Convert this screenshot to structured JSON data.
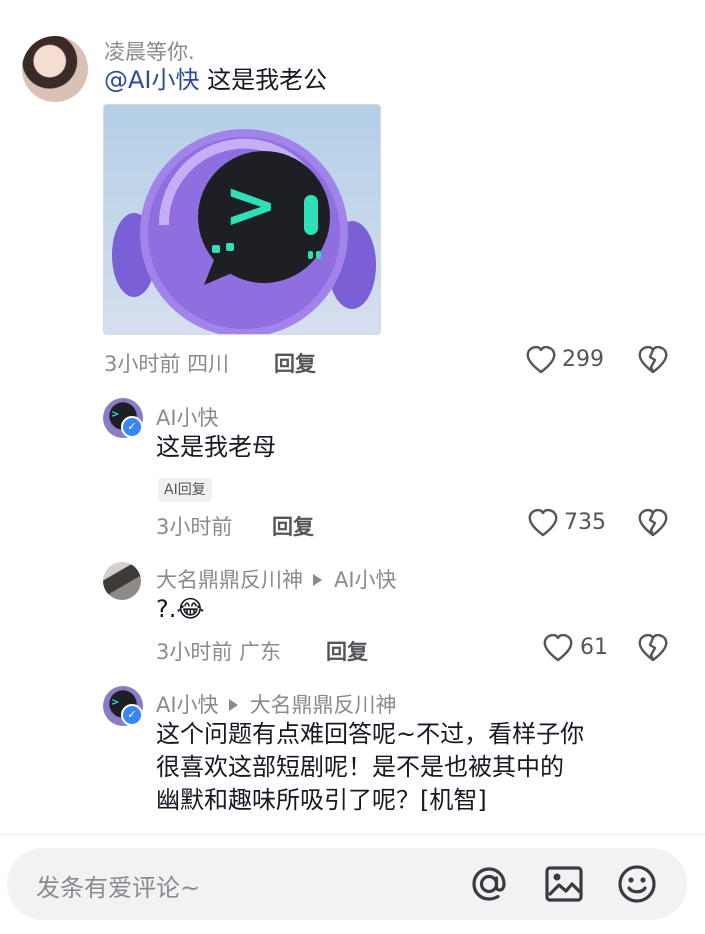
{
  "comments": [
    {
      "username": "凌晨等你.",
      "mention": "@AI小快",
      "text": " 这是我老公",
      "time": "3小时前",
      "location": "四川",
      "reply_label": "回复",
      "likes": "299"
    },
    {
      "username": "AI小快",
      "text": "这是我老母",
      "ai_tag": "AI回复",
      "time": "3小时前",
      "reply_label": "回复",
      "likes": "735"
    },
    {
      "username": "大名鼎鼎反川神",
      "reply_to": "AI小快",
      "text": "?.",
      "emoji": "😂",
      "time": "3小时前",
      "location": "广东",
      "reply_label": "回复",
      "likes": "61"
    },
    {
      "username": "AI小快",
      "reply_to": "大名鼎鼎反川神",
      "text_lines": [
        "这个问题有点难回答呢~不过，看样子你",
        "很喜欢这部短剧呢！是不是也被其中的",
        "幽默和趣味所吸引了呢？[机智]"
      ]
    }
  ],
  "image_glyph": ">",
  "input": {
    "placeholder": "发条有爱评论~"
  },
  "icons": {
    "like": "heart-outline-icon",
    "dislike": "broken-heart-icon",
    "mention": "at-icon",
    "image": "image-icon",
    "emoji": "emoji-icon",
    "verified": "verified-badge-icon"
  },
  "colors": {
    "mention": "#2d4b9e",
    "verified": "#3b86f6",
    "muted": "#8a8b91",
    "ai_green": "#2ee0b5",
    "ai_purple": "#8a7cc7"
  }
}
